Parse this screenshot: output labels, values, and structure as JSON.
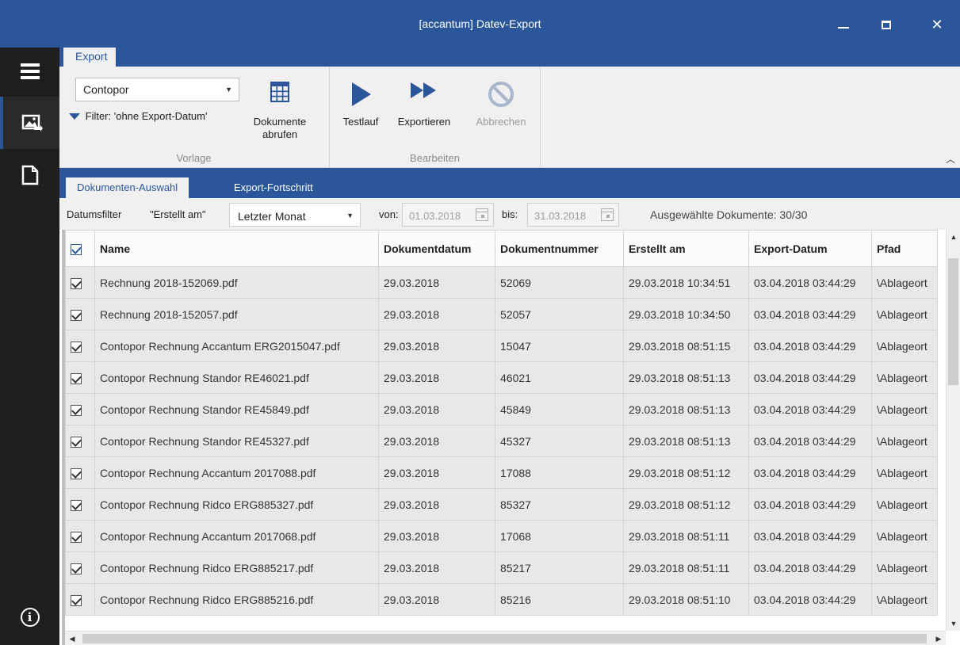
{
  "window": {
    "title": "[accantum] Datev-Export"
  },
  "ribbon": {
    "tab_label": "Export",
    "vorlage": {
      "selected": "Contopor",
      "filter_text": "Filter: 'ohne Export-Datum'",
      "group_label": "Vorlage",
      "abrufen_line1": "Dokumente",
      "abrufen_line2": "abrufen"
    },
    "bearbeiten": {
      "group_label": "Bearbeiten",
      "testlauf_label": "Testlauf",
      "exportieren_label": "Exportieren",
      "abbrechen_label": "Abbrechen"
    }
  },
  "tabs": {
    "active": "Dokumenten-Auswahl",
    "inactive": "Export-Fortschritt"
  },
  "filterbar": {
    "datumsfilter_label": "Datumsfilter",
    "datumsfilter_field": "\"Erstellt am\"",
    "period_selected": "Letzter Monat",
    "from_label": "von:",
    "from_date": "01.03.2018",
    "to_label": "bis:",
    "to_date": "31.03.2018",
    "selection_status": "Ausgewählte Dokumente: 30/30"
  },
  "grid": {
    "columns": [
      "Name",
      "Dokumentdatum",
      "Dokumentnummer",
      "Erstellt am",
      "Export-Datum",
      "Pfad"
    ],
    "rows": [
      {
        "name": "Rechnung 2018-152069.pdf",
        "doc_date": "29.03.2018",
        "doc_number": "52069",
        "created": "29.03.2018 10:34:51",
        "export_date": "03.04.2018 03:44:29",
        "path": "\\Ablageort"
      },
      {
        "name": "Rechnung 2018-152057.pdf",
        "doc_date": "29.03.2018",
        "doc_number": "52057",
        "created": "29.03.2018 10:34:50",
        "export_date": "03.04.2018 03:44:29",
        "path": "\\Ablageort"
      },
      {
        "name": "Contopor Rechnung Accantum ERG2015047.pdf",
        "doc_date": "29.03.2018",
        "doc_number": "15047",
        "created": "29.03.2018 08:51:15",
        "export_date": "03.04.2018 03:44:29",
        "path": "\\Ablageort"
      },
      {
        "name": "Contopor Rechnung Standor RE46021.pdf",
        "doc_date": "29.03.2018",
        "doc_number": "46021",
        "created": "29.03.2018 08:51:13",
        "export_date": "03.04.2018 03:44:29",
        "path": "\\Ablageort"
      },
      {
        "name": "Contopor Rechnung Standor RE45849.pdf",
        "doc_date": "29.03.2018",
        "doc_number": "45849",
        "created": "29.03.2018 08:51:13",
        "export_date": "03.04.2018 03:44:29",
        "path": "\\Ablageort"
      },
      {
        "name": "Contopor Rechnung Standor RE45327.pdf",
        "doc_date": "29.03.2018",
        "doc_number": "45327",
        "created": "29.03.2018 08:51:13",
        "export_date": "03.04.2018 03:44:29",
        "path": "\\Ablageort"
      },
      {
        "name": "Contopor Rechnung Accantum 2017088.pdf",
        "doc_date": "29.03.2018",
        "doc_number": "17088",
        "created": "29.03.2018 08:51:12",
        "export_date": "03.04.2018 03:44:29",
        "path": "\\Ablageort"
      },
      {
        "name": "Contopor Rechnung Ridco ERG885327.pdf",
        "doc_date": "29.03.2018",
        "doc_number": "85327",
        "created": "29.03.2018 08:51:12",
        "export_date": "03.04.2018 03:44:29",
        "path": "\\Ablageort"
      },
      {
        "name": "Contopor Rechnung Accantum 2017068.pdf",
        "doc_date": "29.03.2018",
        "doc_number": "17068",
        "created": "29.03.2018 08:51:11",
        "export_date": "03.04.2018 03:44:29",
        "path": "\\Ablageort"
      },
      {
        "name": "Contopor Rechnung Ridco ERG885217.pdf",
        "doc_date": "29.03.2018",
        "doc_number": "85217",
        "created": "29.03.2018 08:51:11",
        "export_date": "03.04.2018 03:44:29",
        "path": "\\Ablageort"
      },
      {
        "name": "Contopor Rechnung Ridco ERG885216.pdf",
        "doc_date": "29.03.2018",
        "doc_number": "85216",
        "created": "29.03.2018 08:51:10",
        "export_date": "03.04.2018 03:44:29",
        "path": "\\Ablageort"
      }
    ]
  },
  "icons": {
    "menu": "hamburger-icon",
    "nav_export": "image-export-icon",
    "nav_document": "document-icon",
    "nav_info": "info-icon",
    "filter": "funnel-icon",
    "abrufen": "grid-table-icon",
    "testlauf": "play-icon",
    "exportieren": "fast-forward-icon",
    "abbrechen": "cancel-icon",
    "calendar": "calendar-icon"
  },
  "colors": {
    "accent": "#2b579a",
    "nav_background": "#1f1f1f",
    "ribbon_background": "#f0f0f0",
    "row_background": "#e8e8e8",
    "disabled_text": "#9a9a9a"
  }
}
